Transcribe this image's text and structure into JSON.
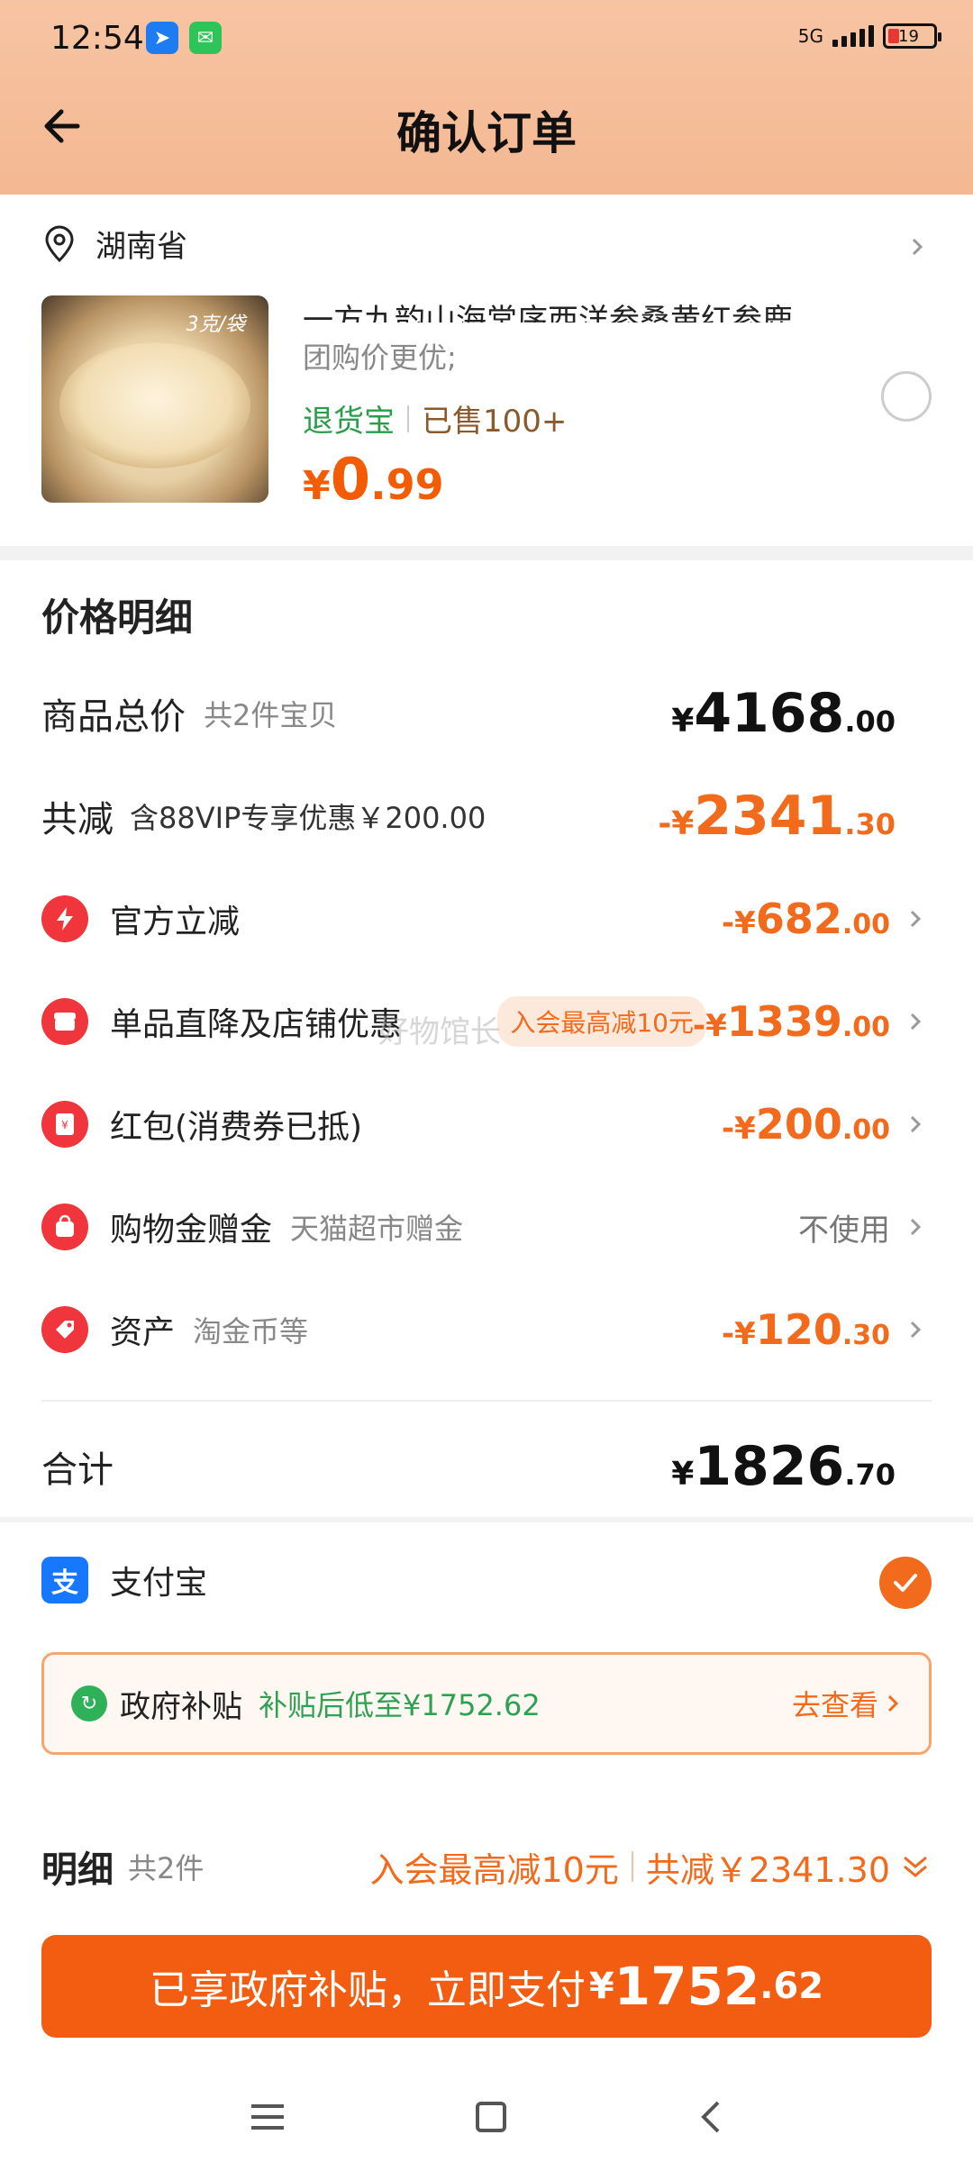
{
  "status_bar": {
    "time": "12:54",
    "network": "5G",
    "battery": "19"
  },
  "header": {
    "title": "确认订单"
  },
  "address": {
    "region": "湖南省"
  },
  "product": {
    "title": "一方九韵山海棠序西洋参桑黄红参鹿",
    "image_tag": "3克/袋",
    "subtitle": "团购价更优;",
    "tag_return": "退货宝",
    "tag_sold": "已售100+",
    "price_symbol": "¥",
    "price_int": "0",
    "price_dec": ".99"
  },
  "price_detail": {
    "title": "价格明细",
    "total": {
      "label": "商品总价",
      "sub": "共2件宝贝",
      "sym": "¥",
      "int": "4168",
      "dec": ".00"
    },
    "reduce": {
      "label": "共减",
      "sub": "含88VIP专享优惠￥200.00",
      "sym": "-¥",
      "int": "2341",
      "dec": ".30"
    },
    "official": {
      "label": "官方立减",
      "sym": "-¥",
      "int": "682",
      "dec": ".00"
    },
    "single": {
      "label": "单品直降及店铺优惠",
      "pill": "入会最高减10元",
      "sym": "-¥",
      "int": "1339",
      "dec": ".00"
    },
    "redpacket": {
      "label": "红包(消费券已抵)",
      "sym": "-¥",
      "int": "200",
      "dec": ".00"
    },
    "shopping": {
      "label": "购物金赠金",
      "sub": "天猫超市赠金",
      "value": "不使用"
    },
    "assets": {
      "label": "资产",
      "sub": "淘金币等",
      "sym": "-¥",
      "int": "120",
      "dec": ".30"
    },
    "sum": {
      "label": "合计",
      "sym": "¥",
      "int": "1826",
      "dec": ".70"
    }
  },
  "watermark": "好物馆长",
  "payment": {
    "method": "支付宝",
    "subsidy_title": "政府补贴",
    "subsidy_text": "补贴后低至¥1752.62",
    "subsidy_link": "去查看"
  },
  "bottom": {
    "detail_label": "明细",
    "detail_count": "共2件",
    "vip_text": "入会最高减10元",
    "reduce_text": "共减￥2341.30",
    "pay_text": "已享政府补贴，立即支付",
    "pay_sym": "¥",
    "pay_int": "1752",
    "pay_dec": ".62"
  },
  "colors": {
    "accent": "#f26a1b",
    "header_bg": "#f5bd99",
    "green": "#2a9d4b",
    "alipay": "#1677ff"
  }
}
